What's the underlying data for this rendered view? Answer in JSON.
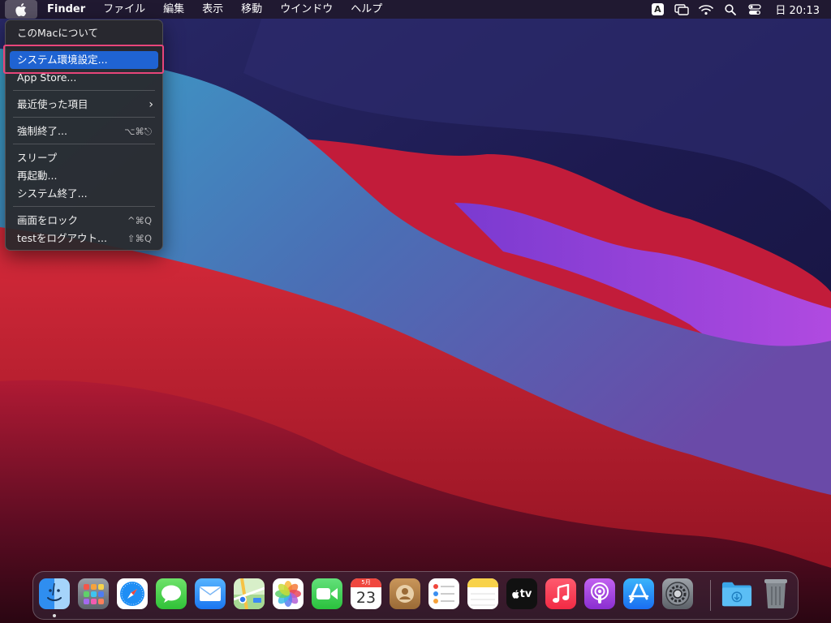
{
  "menubar": {
    "app_name": "Finder",
    "menus": [
      "ファイル",
      "編集",
      "表示",
      "移動",
      "ウインドウ",
      "ヘルプ"
    ],
    "input_source": "A",
    "clock": "日 20:13"
  },
  "apple_menu": {
    "items": {
      "about": "このMacについて",
      "system_prefs": "システム環境設定...",
      "app_store": "App Store...",
      "recent": "最近使った項目",
      "force_quit": "強制終了...",
      "force_quit_shortcut": "⌥⌘⎋",
      "sleep": "スリープ",
      "restart": "再起動...",
      "shutdown": "システム終了...",
      "lock": "画面をロック",
      "lock_shortcut": "^⌘Q",
      "logout": "testをログアウト...",
      "logout_shortcut": "⇧⌘Q"
    }
  },
  "dock": {
    "calendar_month": "5月",
    "calendar_day": "23",
    "tv_label": "tv",
    "apps": [
      "Finder",
      "Launchpad",
      "Safari",
      "Messages",
      "Mail",
      "Maps",
      "Photos",
      "FaceTime",
      "Calendar",
      "Contacts",
      "Reminders",
      "Notes",
      "TV",
      "Music",
      "Podcasts",
      "App Store",
      "System Preferences",
      "Downloads",
      "Trash"
    ]
  },
  "colors": {
    "menu_highlight": "#1f63d2",
    "annotation_box": "#e8457a"
  }
}
